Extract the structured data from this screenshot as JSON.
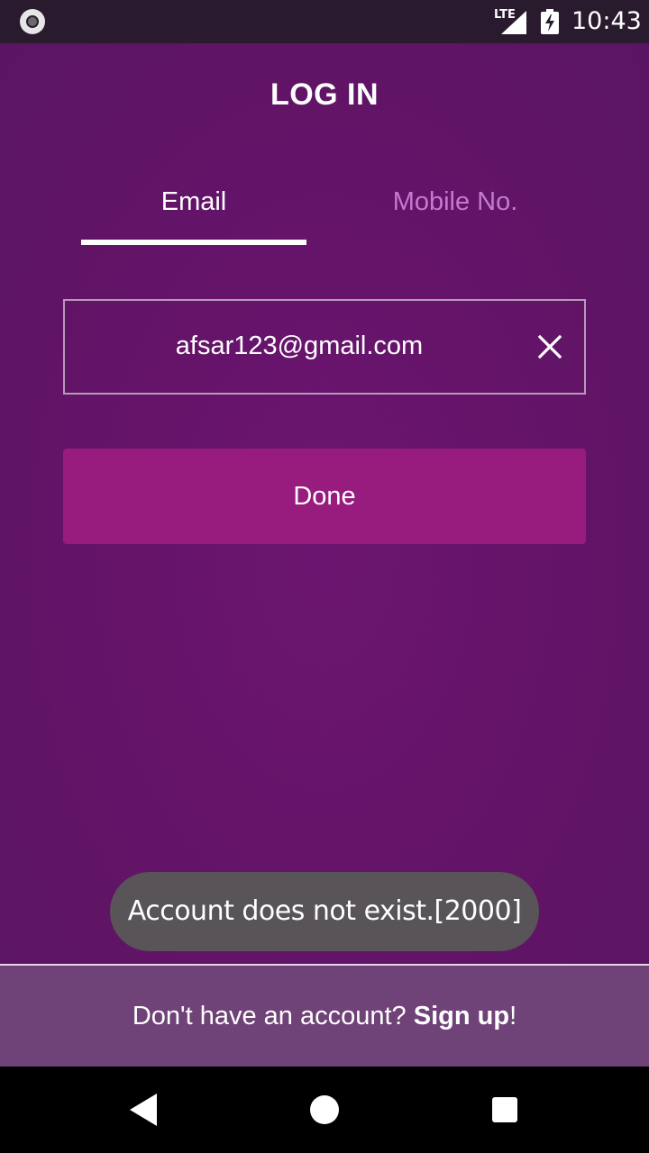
{
  "status_bar": {
    "network_label": "LTE",
    "time": "10:43",
    "icons": [
      "record-icon",
      "signal-icon",
      "battery-charging-icon"
    ]
  },
  "page": {
    "title": "LOG IN"
  },
  "tabs": [
    {
      "label": "Email",
      "selected": true
    },
    {
      "label": "Mobile No.",
      "selected": false
    }
  ],
  "email_field": {
    "value": "afsar123@gmail.com",
    "clear_icon": "close-icon"
  },
  "done_button": {
    "label": "Done"
  },
  "toast": {
    "message": "Account does not exist.[2000]"
  },
  "footer": {
    "prompt": "Don't have an account? ",
    "link": "Sign up",
    "suffix": "!"
  },
  "nav_bar": {
    "icons": [
      "back-icon",
      "home-icon",
      "recents-icon"
    ]
  },
  "colors": {
    "background": "#621467",
    "tab_inactive": "#c57ad0",
    "button": "#981b7e",
    "toast": "#595457",
    "footer": "#6f4278"
  }
}
